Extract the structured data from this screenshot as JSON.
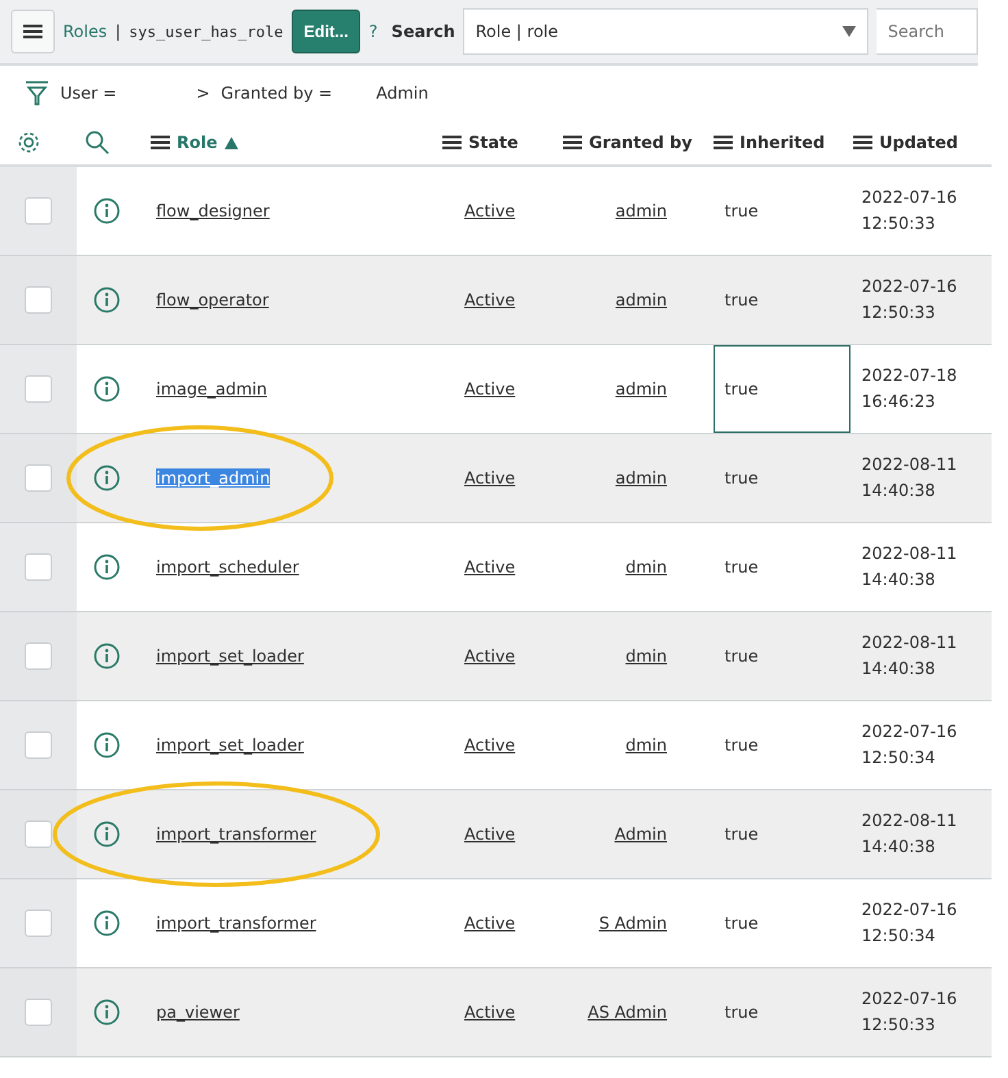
{
  "toolbar": {
    "breadcrumb_link": "Roles",
    "separator": "|",
    "table_name": "sys_user_has_role",
    "edit_button": "Edit...",
    "help": "?",
    "search_label": "Search",
    "search_field": {
      "value": "Role | role"
    },
    "search_input": {
      "placeholder": "Search"
    }
  },
  "filter": {
    "user_part": "User =",
    "separator": ">",
    "granted_part": "Granted by =",
    "granted_value": "Admin"
  },
  "columns": [
    {
      "label": "Role",
      "sorted": true
    },
    {
      "label": "State",
      "sorted": false
    },
    {
      "label": "Granted by",
      "sorted": false
    },
    {
      "label": "Inherited",
      "sorted": false
    },
    {
      "label": "Updated",
      "sorted": false
    }
  ],
  "rows": [
    {
      "checked": false,
      "role": "flow_designer",
      "state": "Active",
      "granted_by": "admin",
      "inherited": "true",
      "updated": [
        "2022-07-16",
        "12:50:33"
      ],
      "text_selected": false,
      "cell_focused": false,
      "circled": false
    },
    {
      "checked": false,
      "role": "flow_operator",
      "state": "Active",
      "granted_by": "admin",
      "inherited": "true",
      "updated": [
        "2022-07-16",
        "12:50:33"
      ],
      "text_selected": false,
      "cell_focused": false,
      "circled": false
    },
    {
      "checked": false,
      "role": "image_admin",
      "state": "Active",
      "granted_by": "admin",
      "inherited": "true",
      "updated": [
        "2022-07-18",
        "16:46:23"
      ],
      "text_selected": false,
      "cell_focused": true,
      "circled": false
    },
    {
      "checked": false,
      "role": "import_admin",
      "state": "Active",
      "granted_by": "admin",
      "inherited": "true",
      "updated": [
        "2022-08-11",
        "14:40:38"
      ],
      "text_selected": true,
      "cell_focused": false,
      "circled": true
    },
    {
      "checked": false,
      "role": "import_scheduler",
      "state": "Active",
      "granted_by": "dmin",
      "inherited": "true",
      "updated": [
        "2022-08-11",
        "14:40:38"
      ],
      "text_selected": false,
      "cell_focused": false,
      "circled": false
    },
    {
      "checked": false,
      "role": "import_set_loader",
      "state": "Active",
      "granted_by": "dmin",
      "inherited": "true",
      "updated": [
        "2022-08-11",
        "14:40:38"
      ],
      "text_selected": false,
      "cell_focused": false,
      "circled": false
    },
    {
      "checked": false,
      "role": "import_set_loader",
      "state": "Active",
      "granted_by": "dmin",
      "inherited": "true",
      "updated": [
        "2022-07-16",
        "12:50:34"
      ],
      "text_selected": false,
      "cell_focused": false,
      "circled": false
    },
    {
      "checked": false,
      "role": "import_transformer",
      "state": "Active",
      "granted_by": "Admin",
      "inherited": "true",
      "updated": [
        "2022-08-11",
        "14:40:38"
      ],
      "text_selected": false,
      "cell_focused": false,
      "circled": true
    },
    {
      "checked": false,
      "role": "import_transformer",
      "state": "Active",
      "granted_by": "S Admin",
      "inherited": "true",
      "updated": [
        "2022-07-16",
        "12:50:34"
      ],
      "text_selected": false,
      "cell_focused": false,
      "circled": false
    },
    {
      "checked": false,
      "role": "pa_viewer",
      "state": "Active",
      "granted_by": "AS Admin",
      "inherited": "true",
      "updated": [
        "2022-07-16",
        "12:50:33"
      ],
      "text_selected": false,
      "cell_focused": false,
      "circled": false
    }
  ]
}
